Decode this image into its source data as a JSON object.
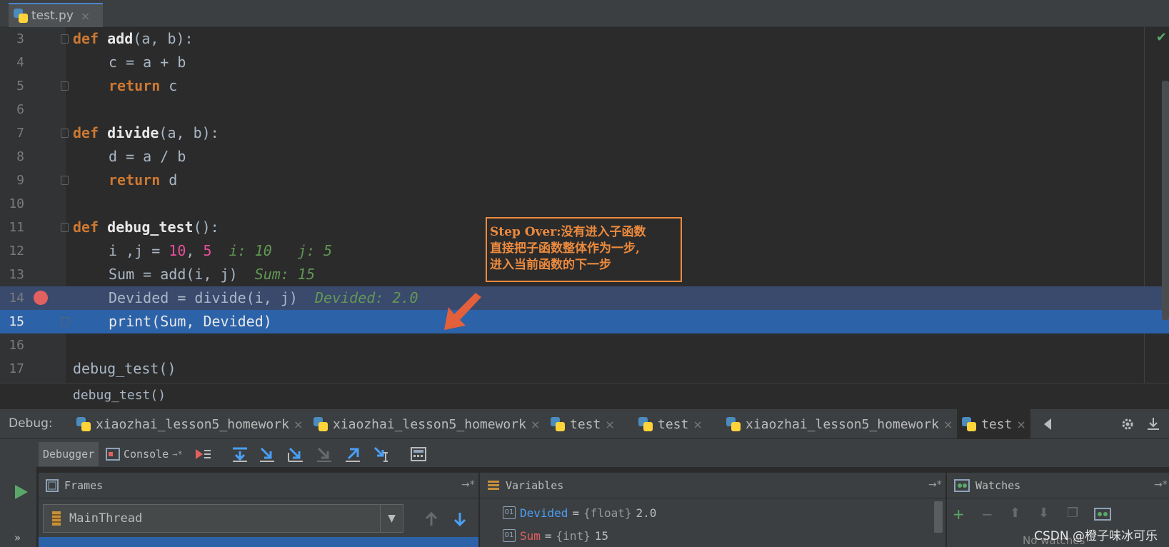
{
  "file_tab": {
    "name": "test.py",
    "close": "×"
  },
  "code_lines": [
    {
      "n": "3"
    },
    {
      "n": "4"
    },
    {
      "n": "5"
    },
    {
      "n": "6"
    },
    {
      "n": "7"
    },
    {
      "n": "8"
    },
    {
      "n": "9"
    },
    {
      "n": "10"
    },
    {
      "n": "11"
    },
    {
      "n": "12"
    },
    {
      "n": "13"
    },
    {
      "n": "14"
    },
    {
      "n": "15"
    },
    {
      "n": "16"
    },
    {
      "n": "17"
    }
  ],
  "code": {
    "l3_kw": "def",
    "l3_fn": "add",
    "l3_rest": "(a, b):",
    "l4": "c = a + b",
    "l5_kw": "return",
    "l5_rest": " c",
    "l7_kw": "def",
    "l7_fn": "divide",
    "l7_rest": "(a, b):",
    "l8": "d = a / b",
    "l9_kw": "return",
    "l9_rest": " d",
    "l11_kw": "def",
    "l11_fn": "debug_test",
    "l11_rest": "():",
    "l12_a": "i ,j = ",
    "l12_n1": "10",
    "l12_b": ", ",
    "l12_n2": "5",
    "l12_hint": "  i: 10   j: 5",
    "l13": "Sum = add(i, j)",
    "l13_hint": "  Sum: 15",
    "l14": "Devided = divide(i, j)",
    "l14_hint": "  Devided: 2.0",
    "l15": "print(Sum, Devided)",
    "l17": "debug_test()"
  },
  "annotation": {
    "line1": "Step Over:没有进入子函数",
    "line2": "直接把子函数整体作为一步,",
    "line3": "进入当前函数的下一步",
    "color": "#ec8a3e"
  },
  "breadcrumb": "debug_test()",
  "debug": {
    "label": "Debug:",
    "tabs": [
      {
        "name": "xiaozhai_lesson5_homework"
      },
      {
        "name": "xiaozhai_lesson5_homework"
      },
      {
        "name": "test"
      },
      {
        "name": "test"
      },
      {
        "name": "xiaozhai_lesson5_homework"
      },
      {
        "name": "test"
      }
    ],
    "close": "×"
  },
  "toolbar": {
    "debugger": "Debugger",
    "console": "Console"
  },
  "frames": {
    "title": "Frames",
    "thread": "MainThread"
  },
  "variables": {
    "title": "Variables",
    "items": [
      {
        "name": "Devided",
        "eq": "=",
        "type": "{float}",
        "value": "2.0"
      },
      {
        "name": "Sum",
        "eq": "=",
        "type": "{int}",
        "value": "15"
      }
    ]
  },
  "watches": {
    "title": "Watches",
    "empty": "No watches"
  },
  "watermark": "CSDN @橙子味冰可乐"
}
